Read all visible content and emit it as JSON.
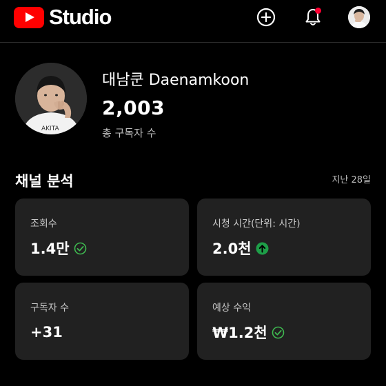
{
  "app": {
    "brand": "Studio"
  },
  "header": {
    "icons": {
      "logo": "youtube-play-logo-icon",
      "create": "create-plus-icon",
      "notifications": "bell-icon",
      "account": "account-avatar"
    },
    "notification_badge_color": "#ff0033"
  },
  "channel": {
    "name": "대남쿤 Daenamkoon",
    "subscribers": "2,003",
    "subscribers_label": "총 구독자 수"
  },
  "analytics": {
    "title": "채널 분석",
    "period": "지난 28일",
    "cards": [
      {
        "label": "조회수",
        "value": "1.4만",
        "status_icon": "check-circle-icon"
      },
      {
        "label": "시청 시간(단위: 시간)",
        "value": "2.0천",
        "status_icon": "arrow-up-circle-icon"
      },
      {
        "label": "구독자 수",
        "value": "+31",
        "status_icon": ""
      },
      {
        "label": "예상 수익",
        "value": "₩1.2천",
        "status_icon": "check-circle-icon"
      }
    ]
  },
  "colors": {
    "background": "#000000",
    "card": "#212121",
    "brand_red": "#ff0000",
    "positive_green": "#1e9e48",
    "check_green": "#3fb950"
  }
}
